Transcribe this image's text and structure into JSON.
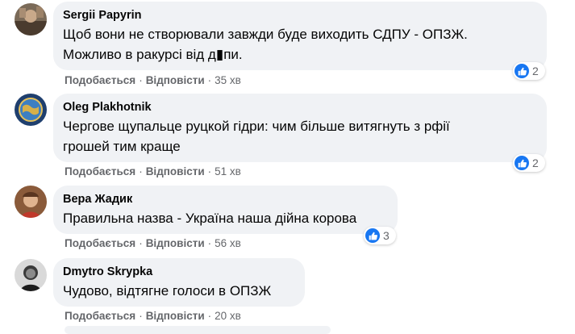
{
  "colors": {
    "bubble": "#f0f2f5",
    "muted": "#65676b",
    "like": "#1877f2"
  },
  "comments": [
    {
      "author": "Sergii Papyrin",
      "lines": [
        "Щоб вони не створювали завжди буде виходить СДПУ - ОПЗЖ.",
        "Можливо в ракурсі від д▮пи."
      ],
      "like_label": "Подобається",
      "reply_label": "Відповісти",
      "time": "35 хв",
      "reactions": "2",
      "avatar_icon": "profile-photo"
    },
    {
      "author": "Oleg Plakhotnik",
      "lines": [
        "Чергове щупальце руцкой гідри: чим більше витягнуть з рфії",
        "грошей тим краще"
      ],
      "like_label": "Подобається",
      "reply_label": "Відповісти",
      "time": "51 хв",
      "reactions": "2",
      "avatar_icon": "globe-photo"
    },
    {
      "author": "Вера Жадик",
      "lines": [
        "Правильна назва - Україна наша дійна корова"
      ],
      "like_label": "Подобається",
      "reply_label": "Відповісти",
      "time": "56 хв",
      "reactions": "3",
      "avatar_icon": "profile-photo"
    },
    {
      "author": "Dmytro Skrypka",
      "lines": [
        "Чудово, відтягне голоси в ОПЗЖ"
      ],
      "like_label": "Подобається",
      "reply_label": "Відповісти",
      "time": "20 хв",
      "avatar_icon": "profile-photo"
    }
  ],
  "separator": "·"
}
